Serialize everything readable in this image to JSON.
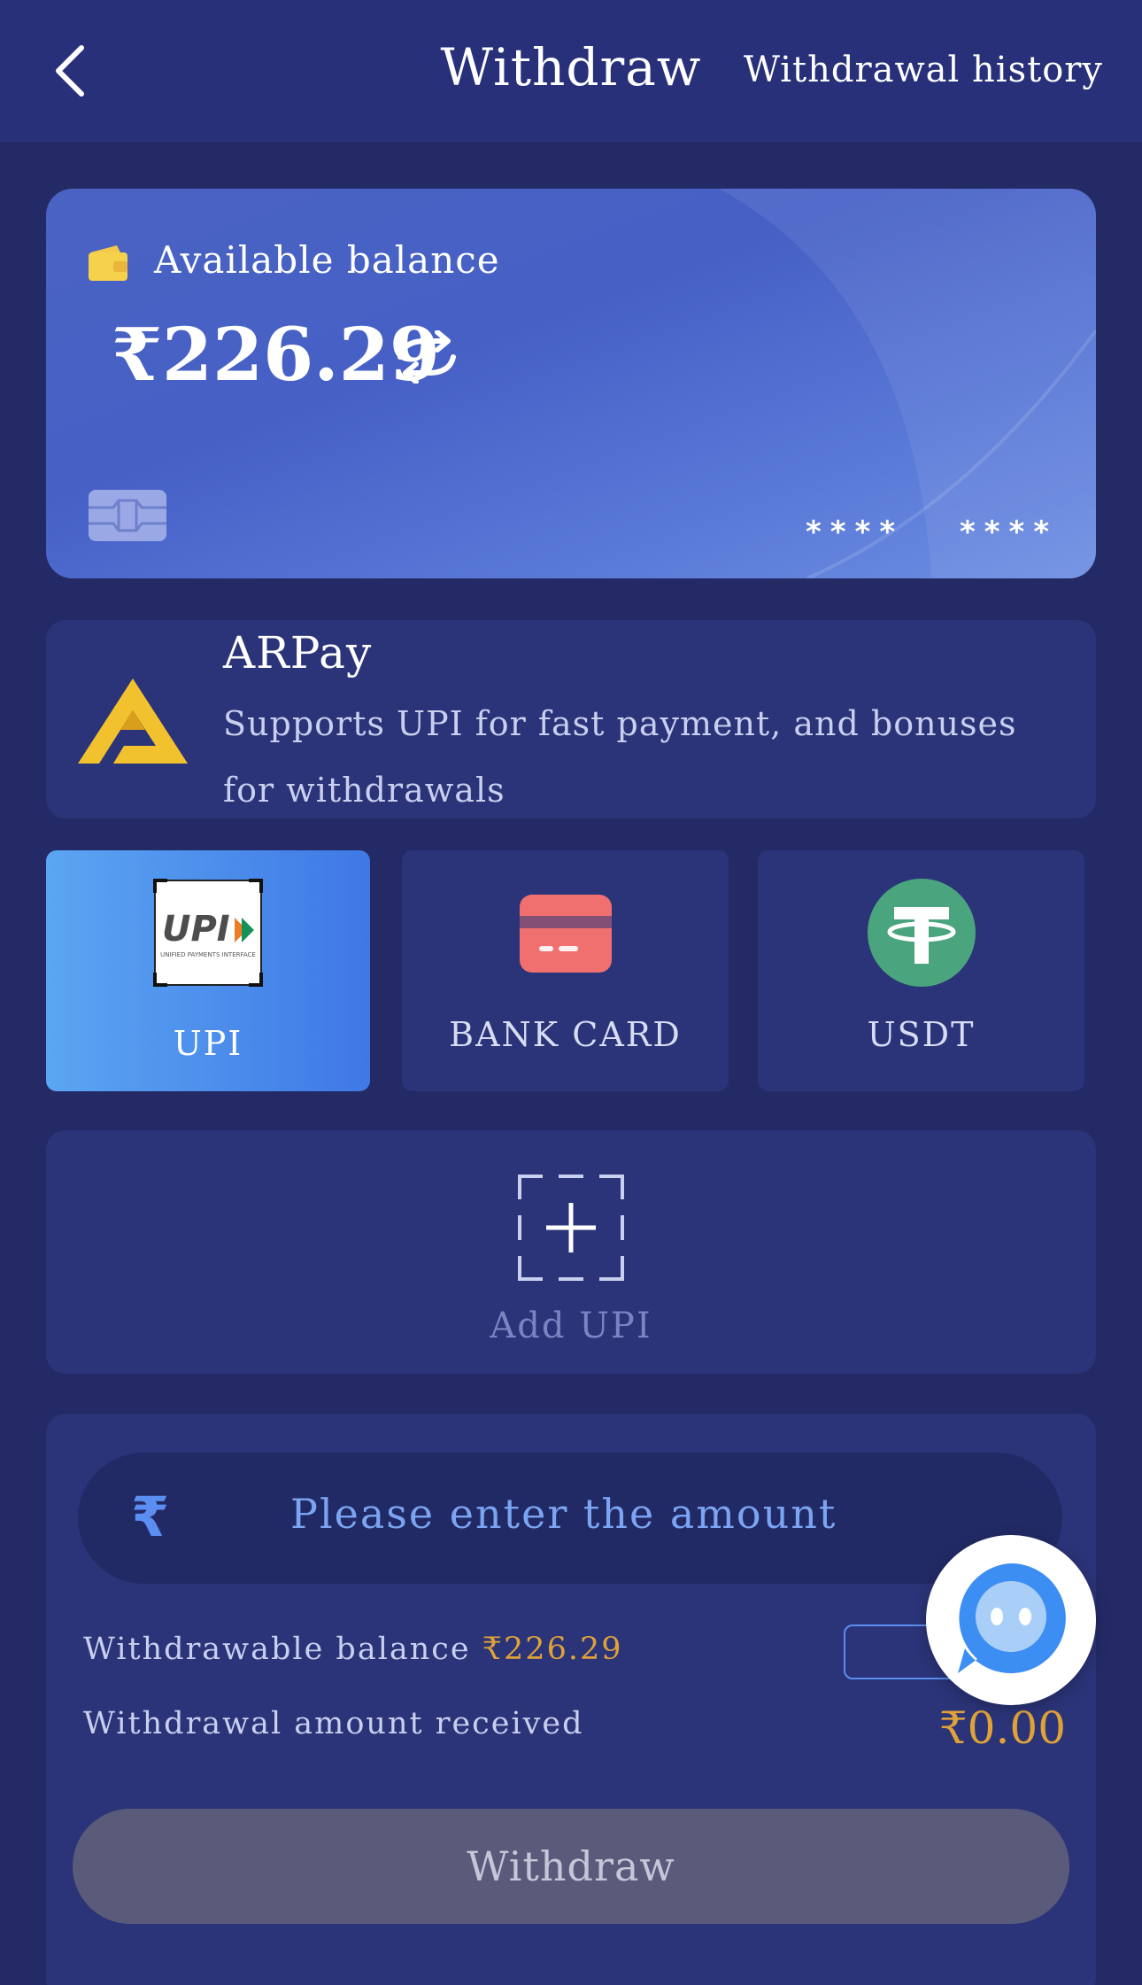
{
  "header": {
    "title": "Withdraw",
    "history_link": "Withdrawal history",
    "back_icon": "chevron-left-icon"
  },
  "balance_card": {
    "label": "Available balance",
    "amount": "₹226.29",
    "masked_1": "****",
    "masked_2": "****",
    "icons": [
      "wallet-icon",
      "refresh-icon",
      "card-chip-icon"
    ]
  },
  "arpay": {
    "title": "ARPay",
    "description": "Supports UPI for fast payment, and bonuses for withdrawals"
  },
  "methods": [
    {
      "label": "UPI",
      "logo_text": "UPI",
      "logo_subtext": "UNIFIED PAYMENTS INTERFACE",
      "selected": true
    },
    {
      "label": "BANK CARD",
      "selected": false
    },
    {
      "label": "USDT",
      "selected": false
    }
  ],
  "add_account": {
    "label": "Add UPI"
  },
  "amount_form": {
    "currency_symbol": "₹",
    "placeholder": "Please enter the amount",
    "withdrawable_label": "Withdrawable balance",
    "withdrawable_value": "₹226.29",
    "received_label": "Withdrawal amount received",
    "received_value": "₹0.00",
    "submit_label": "Withdraw"
  },
  "colors": {
    "background": "#232a66",
    "panel": "#2b3478",
    "accent_blue": "#4a7ee8",
    "gold": "#e0a238",
    "bank_card_red": "#f07070",
    "usdt_green": "#4aa57e"
  }
}
